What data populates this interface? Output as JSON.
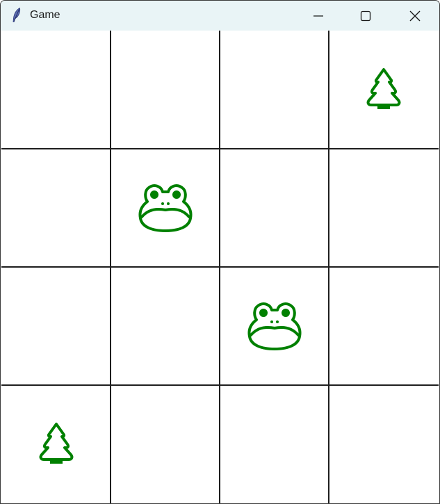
{
  "window": {
    "title": "Game",
    "app_icon": "feather-icon",
    "controls": [
      "minimize-icon",
      "maximize-icon",
      "close-icon"
    ]
  },
  "board": {
    "rows": 4,
    "cols": 4,
    "line_color": "#1e1e1e",
    "piece_color": "#008000",
    "cells": [
      [
        "empty",
        "empty",
        "empty",
        "tree"
      ],
      [
        "empty",
        "frog",
        "empty",
        "empty"
      ],
      [
        "empty",
        "empty",
        "frog",
        "empty"
      ],
      [
        "tree",
        "empty",
        "empty",
        "empty"
      ]
    ]
  }
}
